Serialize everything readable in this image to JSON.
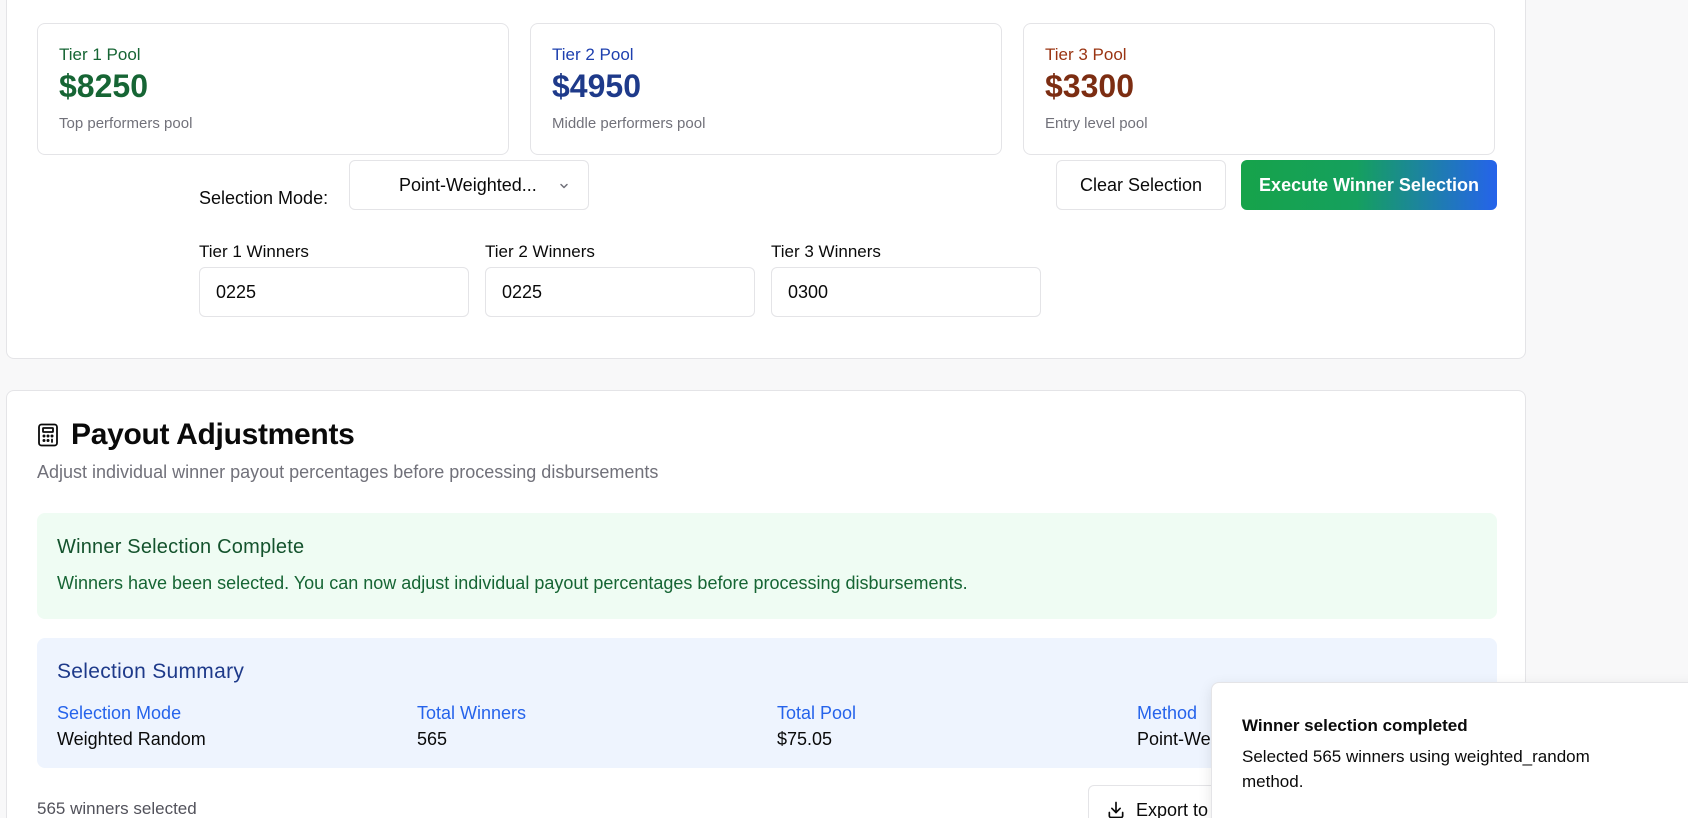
{
  "pools": [
    {
      "title": "Tier 1 Pool",
      "amount": "$8250",
      "description": "Top performers pool",
      "color": "#166534"
    },
    {
      "title": "Tier 2 Pool",
      "amount": "$4950",
      "description": "Middle performers pool",
      "color": "#1e3a8a"
    },
    {
      "title": "Tier 3 Pool",
      "amount": "$3300",
      "description": "Entry level pool",
      "color": "#9a3412"
    }
  ],
  "selection": {
    "mode_label": "Selection Mode:",
    "mode_value": "Point-Weighted...",
    "clear_label": "Clear Selection",
    "execute_label": "Execute Winner Selection"
  },
  "winners": [
    {
      "label": "Tier 1 Winners",
      "value": "0225"
    },
    {
      "label": "Tier 2 Winners",
      "value": "0225"
    },
    {
      "label": "Tier 3 Winners",
      "value": "0300"
    }
  ],
  "payout": {
    "title": "Payout Adjustments",
    "subtitle": "Adjust individual winner payout percentages before processing disbursements",
    "alert_title": "Winner Selection Complete",
    "alert_text": "Winners have been selected. You can now adjust individual payout percentages before processing disbursements.",
    "summary_title": "Selection Summary",
    "summary": [
      {
        "key": "Selection Mode",
        "value": "Weighted Random"
      },
      {
        "key": "Total Winners",
        "value": "565"
      },
      {
        "key": "Total Pool",
        "value": "$75.05"
      },
      {
        "key": "Method",
        "value": "Point-Weighted"
      }
    ],
    "count_text": "565 winners selected",
    "export_label": "Export to CSV"
  },
  "toast": {
    "title": "Winner selection completed",
    "text": "Selected 565 winners using weighted_random method."
  },
  "colors": {
    "accent_green": "#16a34a",
    "accent_blue": "#2563eb",
    "success_bg": "#effcf3",
    "info_bg": "#eef4fe"
  }
}
